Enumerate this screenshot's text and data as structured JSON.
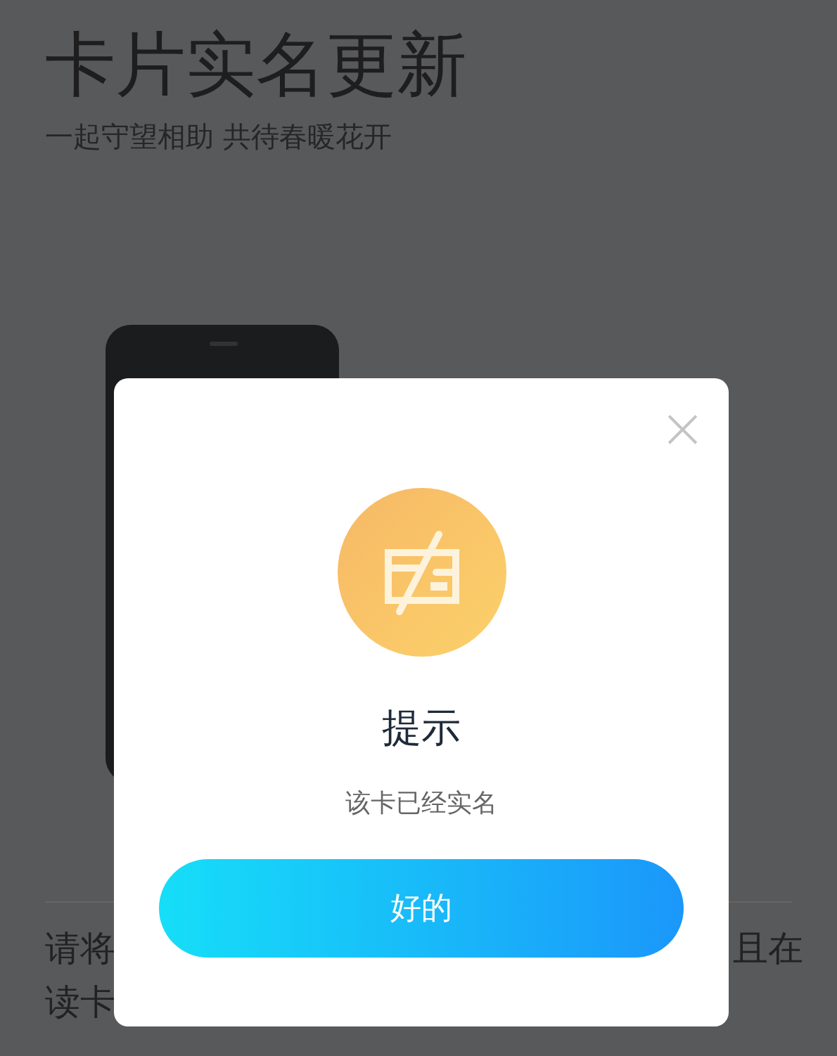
{
  "page": {
    "title": "卡片实名更新",
    "subtitle": "一起守望相助 共待春暖花开",
    "instruction_line_1_start": "请将",
    "instruction_line_1_end": "且在",
    "instruction_line_2_start": "读卡"
  },
  "dialog": {
    "close_icon": "×",
    "title": "提示",
    "message": "该卡已经实名",
    "confirm_button": "好的"
  }
}
